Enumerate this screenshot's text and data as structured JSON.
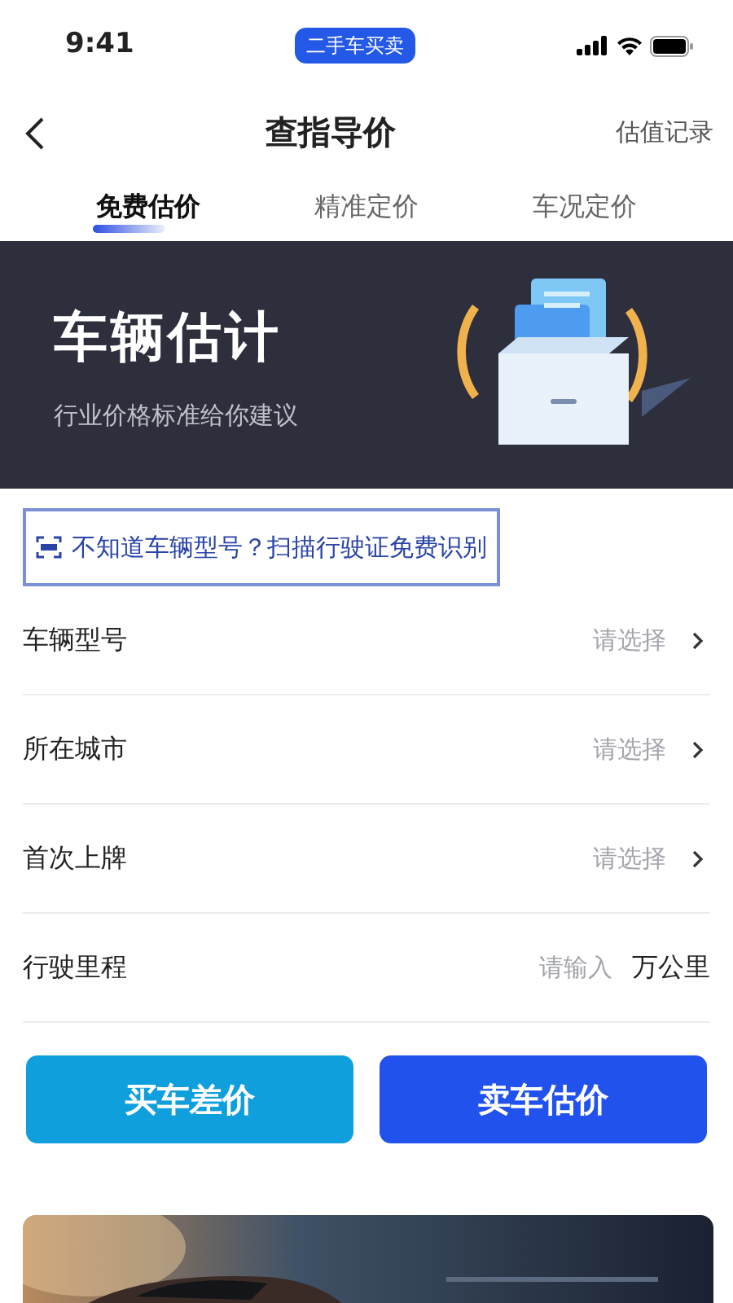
{
  "status_bar": {
    "time": "9:41",
    "app_badge": "二手车买卖"
  },
  "nav": {
    "title": "查指导价",
    "action": "估值记录"
  },
  "tabs": [
    {
      "label": "免费估价",
      "selected": true
    },
    {
      "label": "精准定价",
      "selected": false
    },
    {
      "label": "车况定价",
      "selected": false
    }
  ],
  "hero": {
    "title": "车辆估计",
    "subtitle": "行业价格标准给你建议"
  },
  "scan_hint": "不知道车辆型号？扫描行驶证免费识别",
  "form": [
    {
      "kind": "select",
      "label": "车辆型号",
      "placeholder": "请选择"
    },
    {
      "kind": "select",
      "label": "所在城市",
      "placeholder": "请选择"
    },
    {
      "kind": "select",
      "label": "首次上牌",
      "placeholder": "请选择"
    },
    {
      "kind": "input",
      "label": "行驶里程",
      "placeholder": "请输入",
      "unit": "万公里"
    }
  ],
  "buttons": [
    {
      "label": "买车差价",
      "color": "#0f9fdc"
    },
    {
      "label": "卖车估价",
      "color": "#2152ee"
    }
  ]
}
